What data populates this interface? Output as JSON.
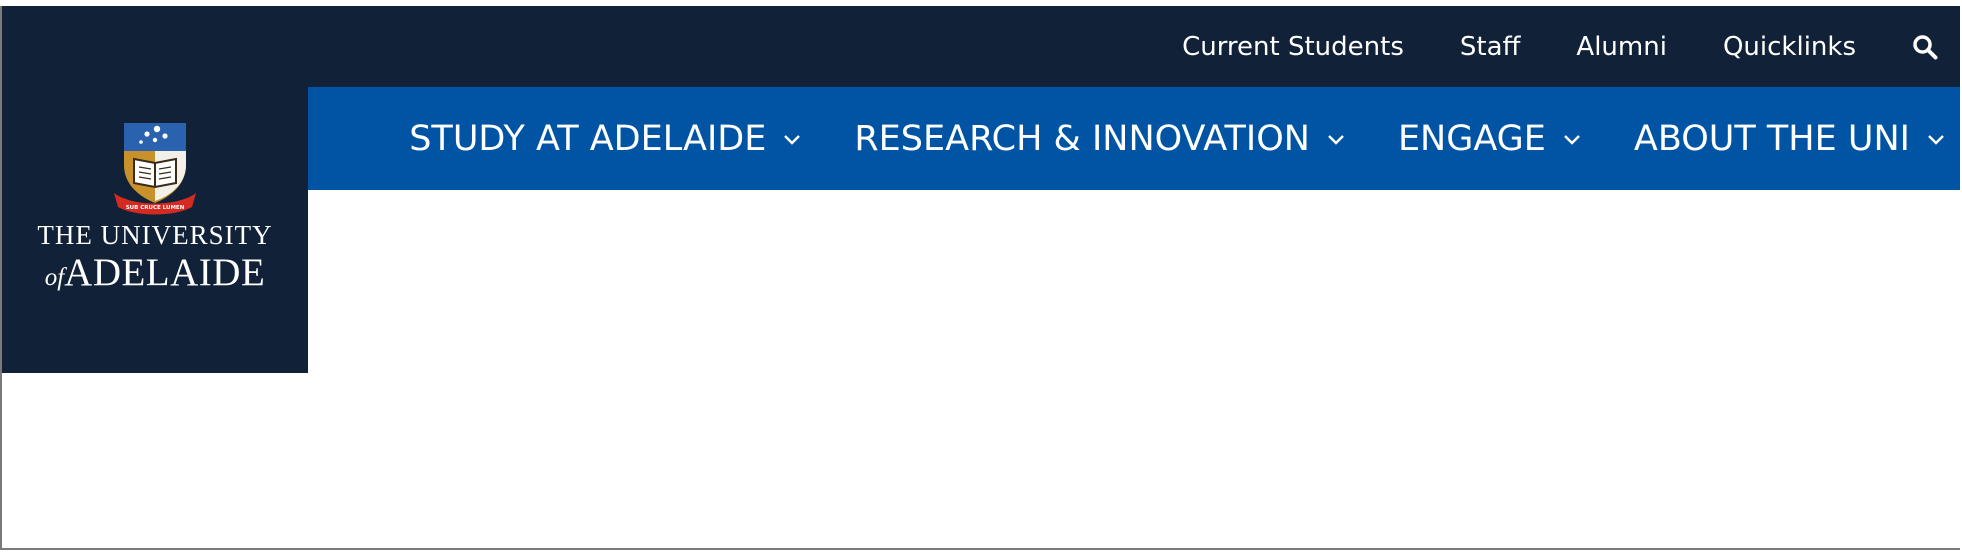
{
  "colors": {
    "topbar_bg": "#112238",
    "mainnav_bg": "#0054a3",
    "text": "#ffffff"
  },
  "topbar": {
    "links": [
      "Current Students",
      "Staff",
      "Alumni",
      "Quicklinks"
    ],
    "search_icon": "search-icon"
  },
  "logo": {
    "line1": "THE UNIVERSITY",
    "of": "of",
    "adelaide": "ADELAIDE",
    "crest_icon": "university-crest-icon",
    "motto": "SUB CRUCE LUMEN"
  },
  "mainnav": {
    "items": [
      {
        "label": "STUDY AT ADELAIDE",
        "icon": "chevron-down-icon"
      },
      {
        "label": "RESEARCH & INNOVATION",
        "icon": "chevron-down-icon"
      },
      {
        "label": "ENGAGE",
        "icon": "chevron-down-icon"
      },
      {
        "label": "ABOUT THE UNI",
        "icon": "chevron-down-icon"
      }
    ]
  }
}
